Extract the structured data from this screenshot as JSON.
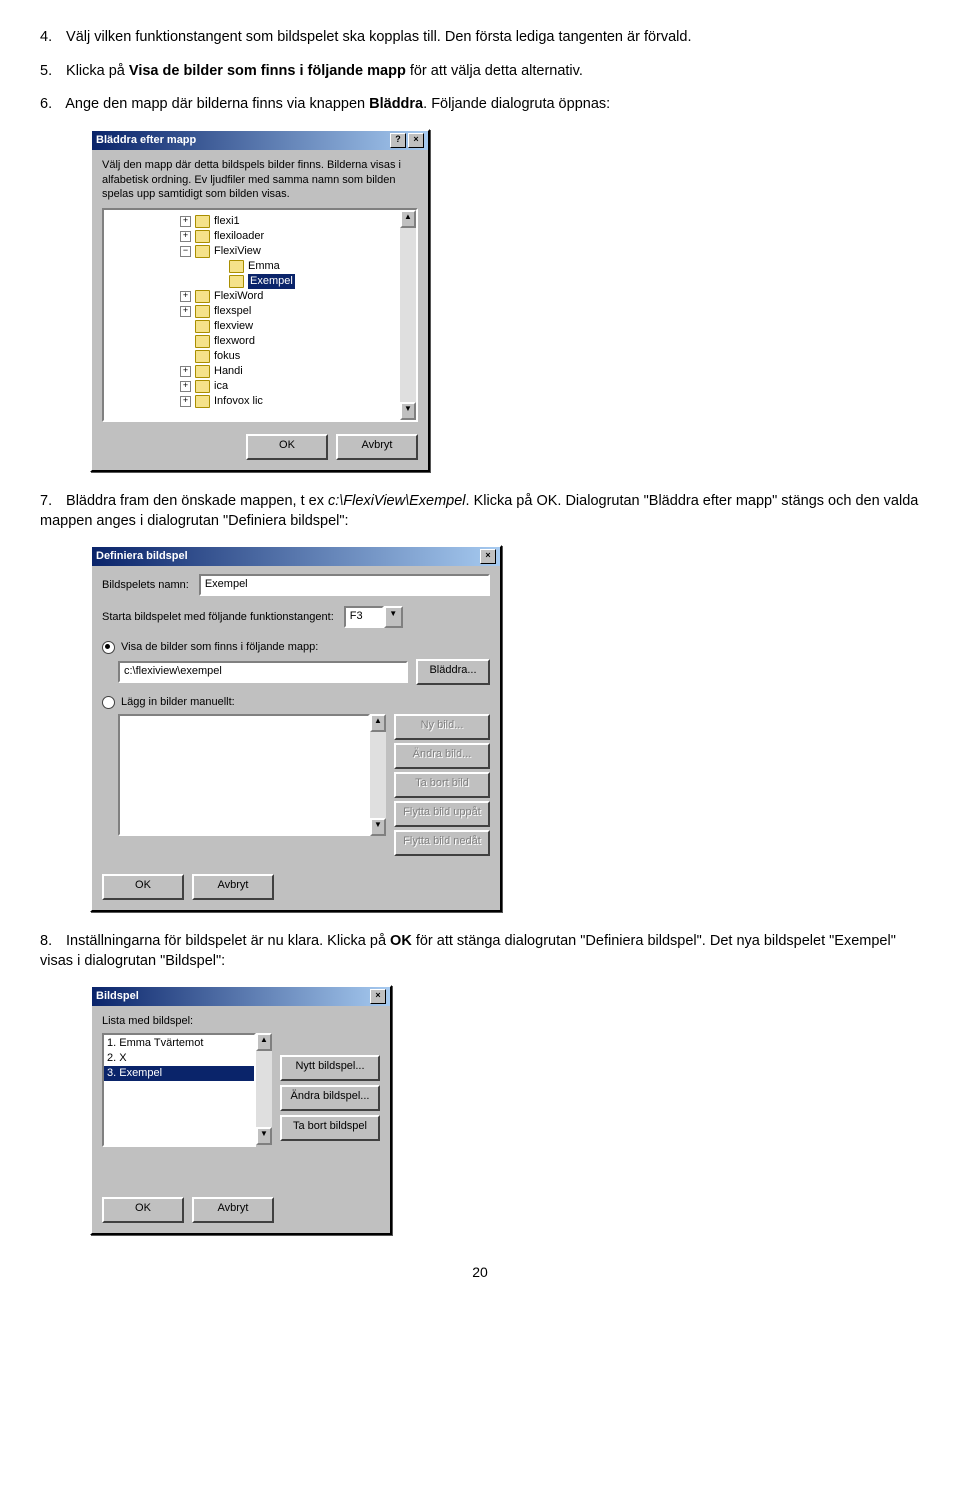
{
  "doc": {
    "p4": "Välj vilken funktionstangent som bildspelet ska kopplas till. Den första lediga tangenten är förvald.",
    "p5a": "Klicka på ",
    "p5b": "Visa de bilder som finns i följande mapp",
    "p5c": " för att välja detta alternativ.",
    "p6a": "Ange den mapp där bilderna finns via knappen ",
    "p6b": "Bläddra",
    "p6c": ". Följande dialogruta öppnas:",
    "p7a": "Bläddra fram den önskade mappen, t ex ",
    "p7b": "c:\\FlexiView\\Exempel",
    "p7c": ". Klicka på OK. Dialogrutan \"Bläddra efter mapp\" stängs och den valda mappen anges i dialogrutan \"Definiera bildspel\":",
    "p8a": "Inställningarna för bildspelet är nu klara. Klicka på ",
    "p8b": "OK",
    "p8c": " för att stänga dialogrutan \"Definiera bildspel\". Det nya bildspelet \"Exempel\" visas i dialogrutan \"Bildspel\":",
    "n4": "4.",
    "n5": "5.",
    "n6": "6.",
    "n7": "7.",
    "n8": "8.",
    "page": "20"
  },
  "dlg1": {
    "title": "Bläddra efter mapp",
    "help": "?",
    "close": "×",
    "desc": "Välj den mapp där detta bildspels bilder finns. Bilderna visas i alfabetisk ordning. Ev ljudfiler med samma namn som bilden spelas upp samtidigt som bilden visas.",
    "ok": "OK",
    "cancel": "Avbryt",
    "tree": [
      {
        "pad": 70,
        "exp": "+",
        "label": "flexi1"
      },
      {
        "pad": 70,
        "exp": "+",
        "label": "flexiloader"
      },
      {
        "pad": 70,
        "exp": "−",
        "label": "FlexiView"
      },
      {
        "pad": 104,
        "exp": "",
        "label": "Emma"
      },
      {
        "pad": 104,
        "exp": "",
        "label": "Exempel",
        "sel": true
      },
      {
        "pad": 70,
        "exp": "+",
        "label": "FlexiWord"
      },
      {
        "pad": 70,
        "exp": "+",
        "label": "flexspel"
      },
      {
        "pad": 70,
        "exp": "",
        "label": "flexview"
      },
      {
        "pad": 70,
        "exp": "",
        "label": "flexword"
      },
      {
        "pad": 70,
        "exp": "",
        "label": "fokus"
      },
      {
        "pad": 70,
        "exp": "+",
        "label": "Handi"
      },
      {
        "pad": 70,
        "exp": "+",
        "label": "ica"
      },
      {
        "pad": 70,
        "exp": "+",
        "label": "Infovox lic"
      }
    ]
  },
  "dlg2": {
    "title": "Definiera bildspel",
    "close": "×",
    "lbl_name": "Bildspelets namn:",
    "name_val": "Exempel",
    "lbl_fkey": "Starta bildspelet med följande funktionstangent:",
    "fkey_val": "F3",
    "opt_folder": "Visa de bilder som finns i följande mapp:",
    "path_val": "c:\\flexiview\\exempel",
    "browse": "Bläddra...",
    "opt_manual": "Lägg in bilder manuellt:",
    "btns": [
      "Ny bild...",
      "Ändra bild...",
      "Ta bort bild",
      "Flytta bild uppåt",
      "Flytta bild nedåt"
    ],
    "ok": "OK",
    "cancel": "Avbryt"
  },
  "dlg3": {
    "title": "Bildspel",
    "close": "×",
    "lbl": "Lista med bildspel:",
    "items": [
      "1. Emma Tvärtemot",
      "2. X",
      "3. Exempel"
    ],
    "sel": 2,
    "btns": [
      "Nytt bildspel...",
      "Ändra bildspel...",
      "Ta bort bildspel"
    ],
    "ok": "OK",
    "cancel": "Avbryt"
  }
}
